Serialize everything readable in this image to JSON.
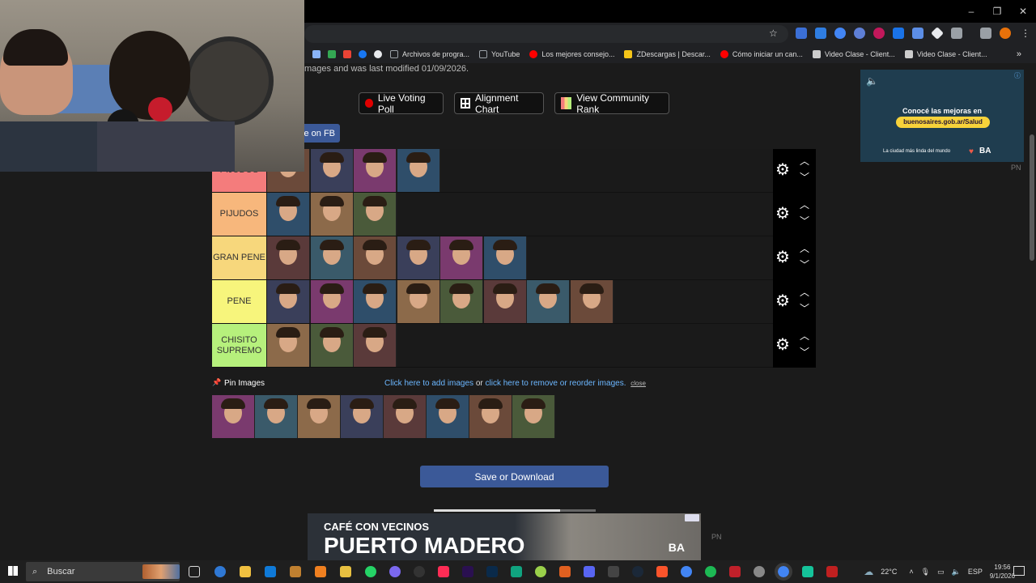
{
  "browser": {
    "window_controls": [
      "–",
      "❐",
      "✕"
    ],
    "bookmarks": [
      {
        "label": "Archivos de progra...",
        "color": "#9aa0a6"
      },
      {
        "label": "YouTube",
        "color": "#9aa0a6"
      },
      {
        "label": "Los mejores consejo...",
        "color": "#ff0000"
      },
      {
        "label": "ZDescargas | Descar...",
        "color": "#f5c518"
      },
      {
        "label": "Cómo iniciar un can...",
        "color": "#ff0000"
      },
      {
        "label": "Video Clase - Client...",
        "color": "#444"
      },
      {
        "label": "Video Clase - Client...",
        "color": "#444"
      }
    ]
  },
  "page": {
    "meta_text": "mages and was last modified 01/09/2026.",
    "buttons": {
      "live_voting": "Live Voting Poll",
      "alignment_chart": "Alignment Chart",
      "community_rank": "View Community Rank"
    },
    "share_fb": "re on FB",
    "tiers": [
      {
        "label": "PIJUDOS",
        "color": "#f47c7c",
        "count": 4
      },
      {
        "label": "PIJUDOS",
        "color": "#f7b77c",
        "count": 3
      },
      {
        "label": "GRAN PENE",
        "color": "#f7d77c",
        "count": 6
      },
      {
        "label": "PENE",
        "color": "#f7f57c",
        "count": 8
      },
      {
        "label": "CHISITO\nSUPREMO",
        "color": "#b6f07c",
        "count": 3
      }
    ],
    "tier_controls": {
      "gear": "⚙",
      "up": "︿",
      "down": "﹀"
    },
    "pin_images": "Pin Images",
    "pin_icon": "📌",
    "add_images": "Click here to add images",
    "or": " or ",
    "remove_reorder": "click here to remove or reorder images.",
    "close": "close",
    "pool_count": 8,
    "save": "Save or Download"
  },
  "ads": {
    "side": {
      "line1": "Conocé las mejoras en",
      "line2": "buenosaires.gob.ar/Salud",
      "line3": "La ciudad más linda del mundo",
      "brand": "BA"
    },
    "pn": "PN",
    "bottom": {
      "line1": "CAFÉ CON VECINOS",
      "line2": "PUERTO MADERO",
      "brand": "BA"
    }
  },
  "taskbar": {
    "search_placeholder": "Buscar",
    "weather": "22°C",
    "lang": "ESP",
    "time": "19:56",
    "date": "9/1/2026"
  }
}
